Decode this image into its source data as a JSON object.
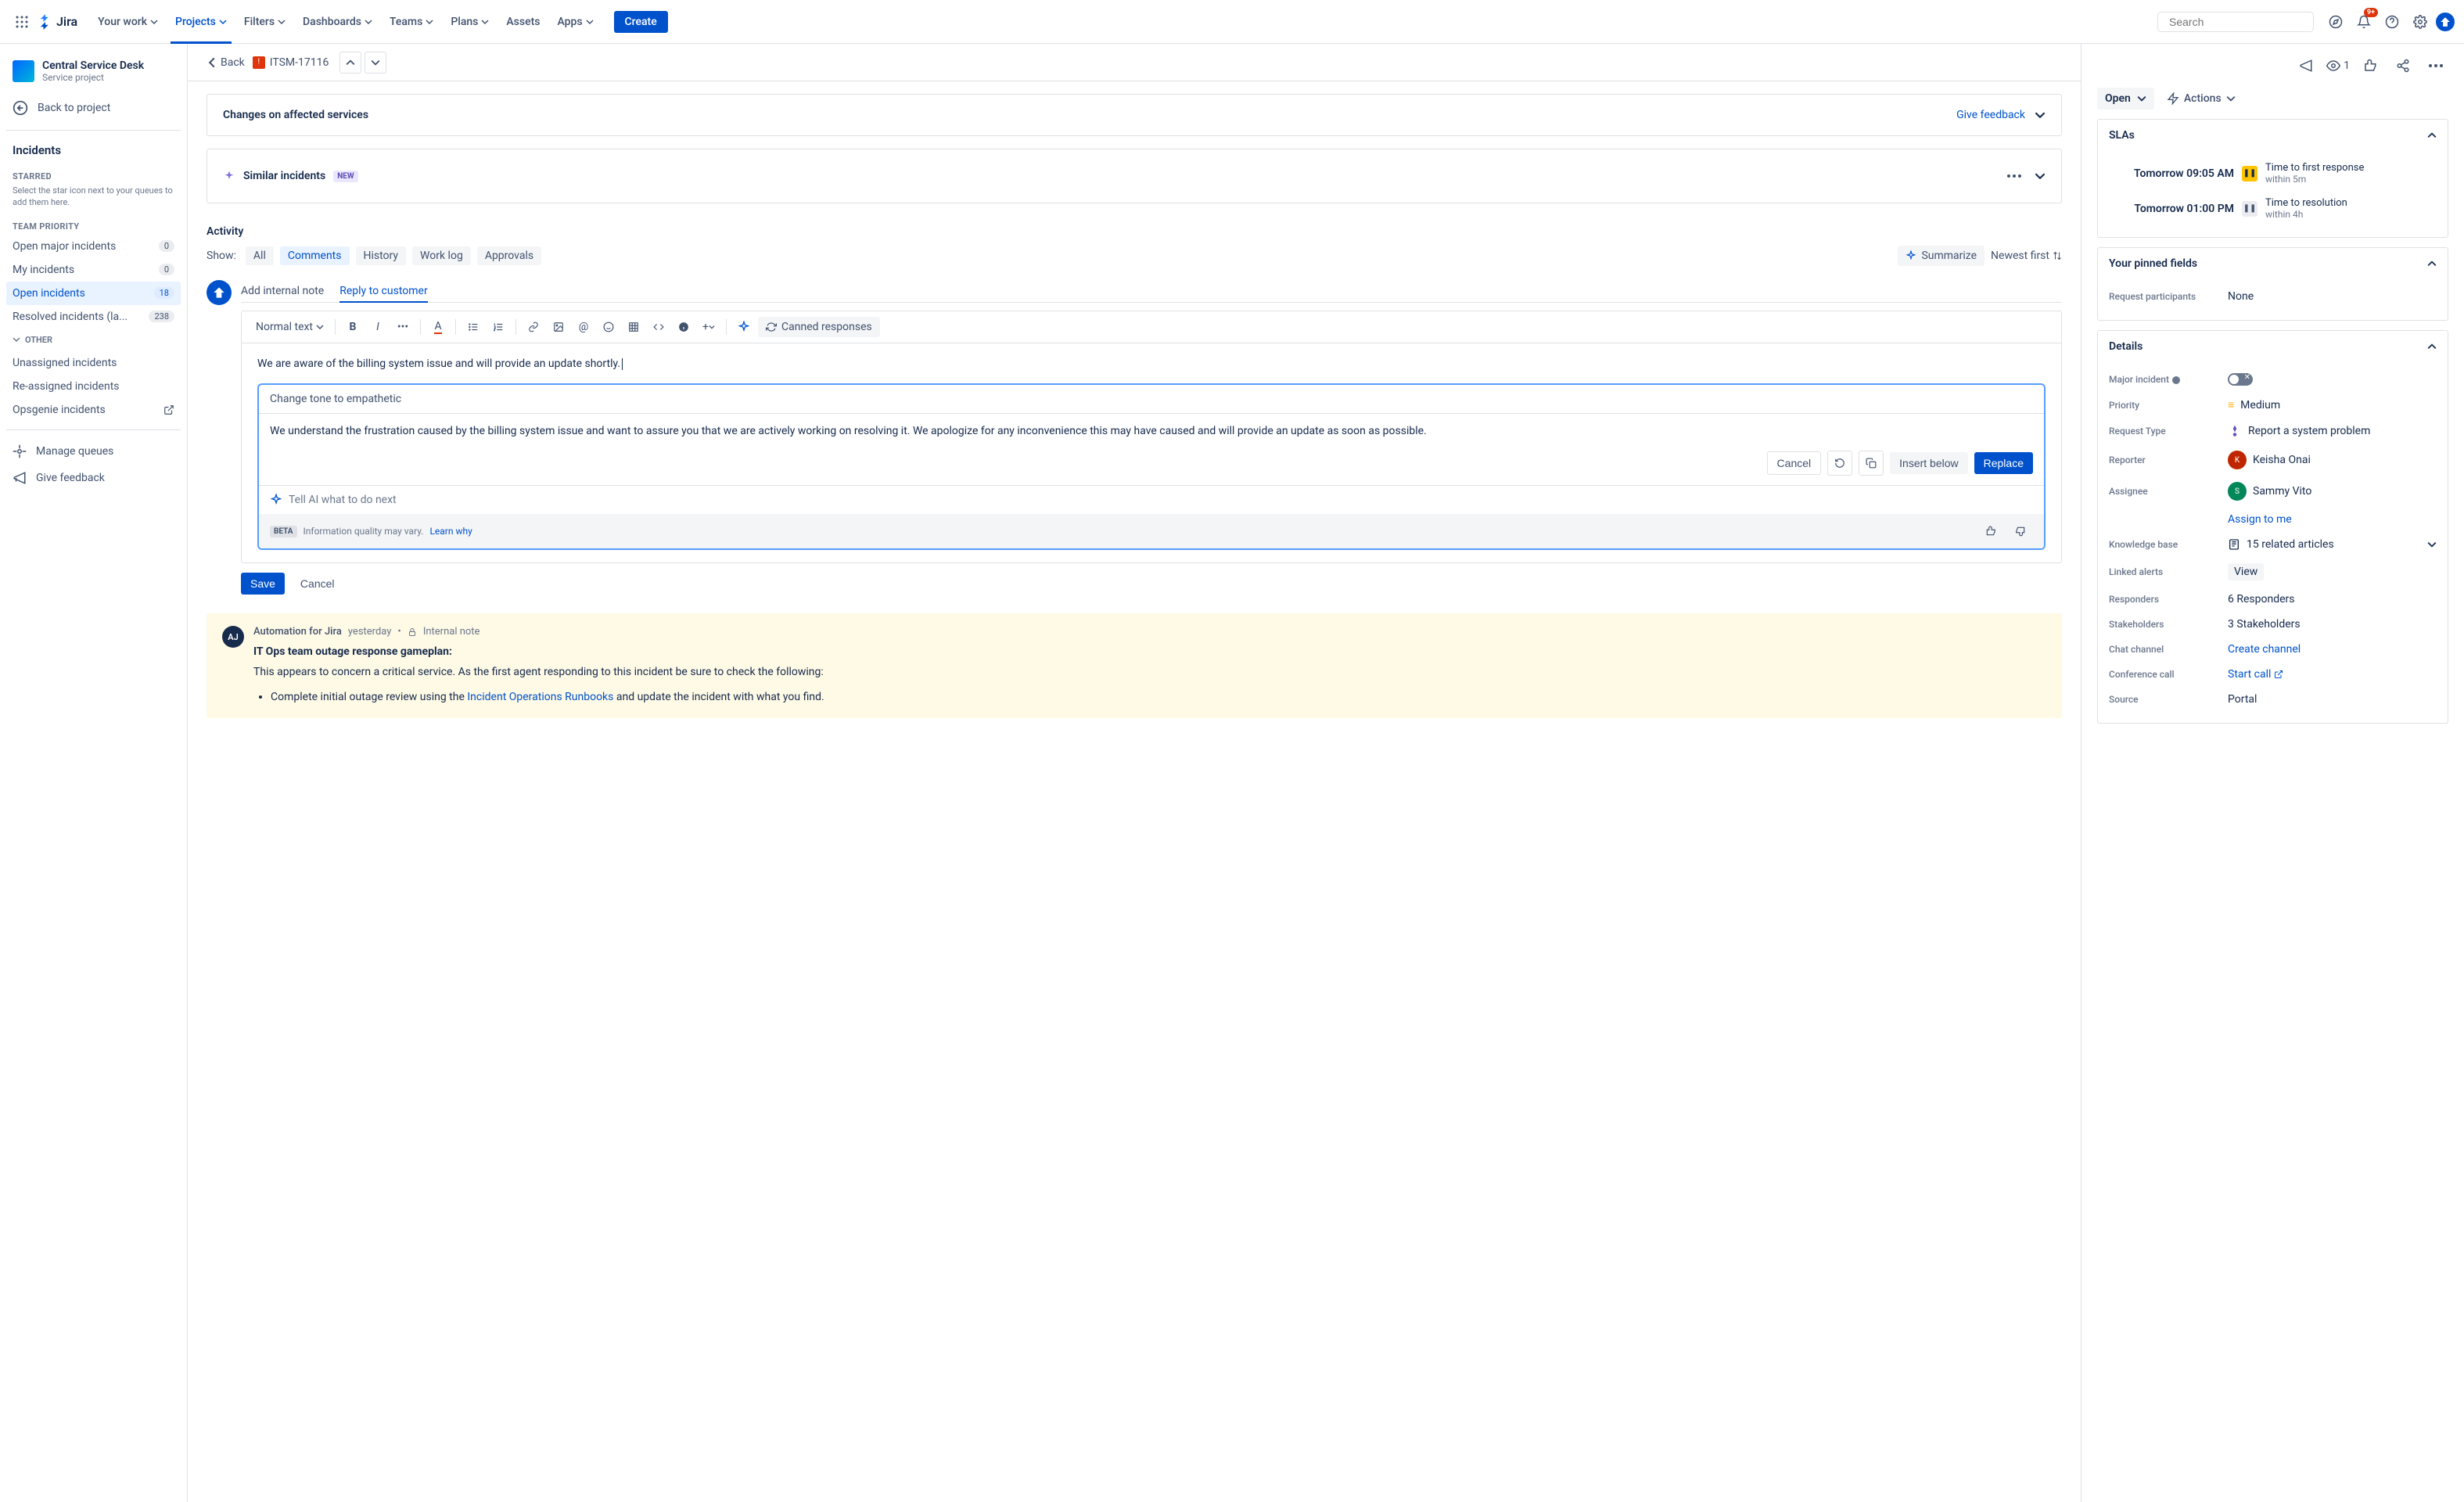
{
  "nav": {
    "logo": "Jira",
    "items": [
      "Your work",
      "Projects",
      "Filters",
      "Dashboards",
      "Teams",
      "Plans",
      "Assets",
      "Apps"
    ],
    "create": "Create",
    "search_placeholder": "Search",
    "notif_badge": "9+"
  },
  "sidebar": {
    "project_name": "Central Service Desk",
    "project_sub": "Service project",
    "back": "Back to project",
    "heading": "Incidents",
    "starred_label": "STARRED",
    "starred_hint": "Select the star icon next to your queues to add them here.",
    "priority_label": "TEAM PRIORITY",
    "queues": [
      {
        "label": "Open major incidents",
        "count": "0"
      },
      {
        "label": "My incidents",
        "count": "0"
      },
      {
        "label": "Open incidents",
        "count": "18",
        "active": true
      },
      {
        "label": "Resolved incidents (la...",
        "count": "238"
      }
    ],
    "other_label": "OTHER",
    "other_items": [
      {
        "label": "Unassigned incidents"
      },
      {
        "label": "Re-assigned incidents"
      },
      {
        "label": "Opsgenie incidents",
        "ext": true
      }
    ],
    "manage": "Manage queues",
    "feedback": "Give feedback"
  },
  "crumb": {
    "back": "Back",
    "key": "ITSM-17116"
  },
  "affected": {
    "title": "Changes on affected services",
    "link": "Give feedback"
  },
  "similar": {
    "title": "Similar incidents",
    "badge": "NEW"
  },
  "activity": {
    "title": "Activity",
    "show": "Show:",
    "tabs": [
      "All",
      "Comments",
      "History",
      "Work log",
      "Approvals"
    ],
    "summarize": "Summarize",
    "sort": "Newest first"
  },
  "comment": {
    "tab_note": "Add internal note",
    "tab_reply": "Reply to customer",
    "text_style": "Normal text",
    "canned": "Canned responses",
    "draft": "We are aware of the billing system issue and will provide an update shortly.",
    "ai_prompt": "Change tone to empathetic",
    "ai_suggestion": "We understand the frustration caused by the billing system issue and want to assure you that we are actively working on resolving it. We apologize for any inconvenience this may have caused and will provide an update as soon as possible.",
    "cancel": "Cancel",
    "insert_below": "Insert below",
    "replace": "Replace",
    "ai_next": "Tell AI what to do next",
    "beta": "BETA",
    "info": "Information quality may vary.",
    "learn": "Learn why",
    "save": "Save",
    "cancel2": "Cancel"
  },
  "auto": {
    "initials": "AJ",
    "author": "Automation for Jira",
    "when": "yesterday",
    "note_label": "Internal note",
    "title": "IT Ops team outage response gameplan:",
    "line1": "This appears to concern a critical service. As the first agent responding to this incident be sure to check the following:",
    "bullet_pre": "Complete initial outage review using the ",
    "bullet_link": "Incident Operations Runbooks",
    "bullet_post": " and update the incident with what you find."
  },
  "right": {
    "watch_count": "1",
    "status": "Open",
    "actions": "Actions",
    "slas_title": "SLAs",
    "sla1": {
      "time": "Tomorrow 09:05 AM",
      "title": "Time to first response",
      "sub": "within 5m"
    },
    "sla2": {
      "time": "Tomorrow 01:00 PM",
      "title": "Time to resolution",
      "sub": "within 4h"
    },
    "pinned_title": "Your pinned fields",
    "pinned_field": "Request participants",
    "pinned_val": "None",
    "details_title": "Details",
    "major_label": "Major incident",
    "priority_label": "Priority",
    "priority_val": "Medium",
    "reqtype_label": "Request Type",
    "reqtype_val": "Report a system problem",
    "reporter_label": "Reporter",
    "reporter_val": "Keisha Onai",
    "assignee_label": "Assignee",
    "assignee_val": "Sammy Vito",
    "assign_me": "Assign to me",
    "kb_label": "Knowledge base",
    "kb_val": "15 related articles",
    "alerts_label": "Linked alerts",
    "alerts_val": "View",
    "responders_label": "Responders",
    "responders_val": "6 Responders",
    "stake_label": "Stakeholders",
    "stake_val": "3 Stakeholders",
    "chat_label": "Chat channel",
    "chat_val": "Create channel",
    "conf_label": "Conference call",
    "conf_val": "Start call",
    "source_label": "Source",
    "source_val": "Portal"
  }
}
